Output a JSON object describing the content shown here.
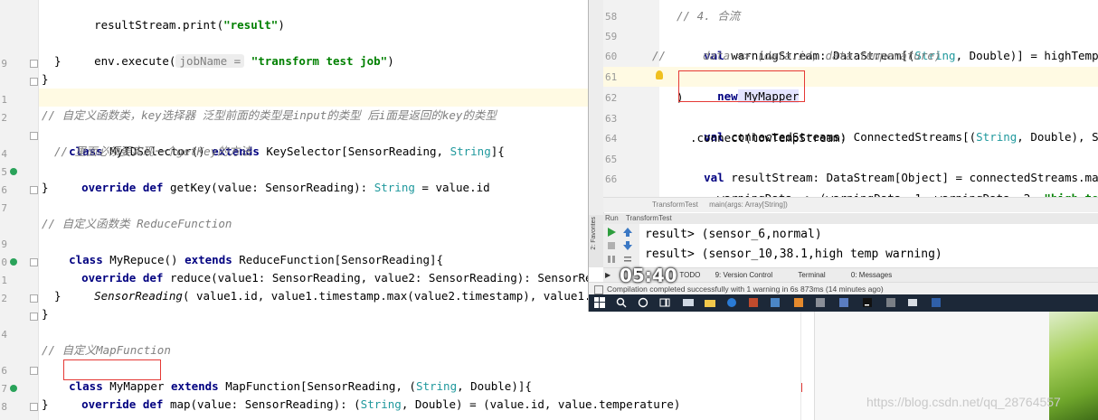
{
  "left_editor": {
    "line_numbers": [
      "",
      "",
      "",
      "9",
      "",
      "1",
      "2",
      "",
      "4",
      "5",
      "6",
      "7",
      "",
      "9",
      "0",
      "1",
      "2",
      "",
      "4",
      "",
      "6",
      "7",
      "8",
      ""
    ],
    "l_result_print_code": "resultStream.print(",
    "l_result_print_str": "\"result\"",
    "l_result_print_end": ")",
    "l_execute_code": "env.execute(",
    "l_execute_hint": "jobName =",
    "l_execute_str": "\"transform test job\"",
    "l_execute_end": ")",
    "brace_close": "}",
    "c_custom_func_class": "// 自定义函数类，key选择器 泛型前面的类型是input的类型 后i面是返回的key的类型",
    "l_idselector_kw": "class",
    "l_idselector_name": " MyIDSelector() ",
    "l_idselector_ext": "extends",
    "l_idselector_rest": " KeySelector[SensorReading, ",
    "l_idselector_type": "String",
    "l_idselector_end": "]{",
    "c_must_impl": "// 里面必须要实现一个getKey的方法",
    "l_getkey_kw": "override def",
    "l_getkey_rest": " getKey(value: SensorReading): ",
    "l_getkey_type": "String",
    "l_getkey_end": " = value.id",
    "c_reduce": "// 自定义函数类 ReduceFunction",
    "l_myrepuce_kw": "class",
    "l_myrepuce_name": " MyRepuce() ",
    "l_myrepuce_ext": "extends",
    "l_myrepuce_rest": " ReduceFunction[SensorReading]{",
    "l_reduce_kw": "override def",
    "l_reduce_rest": " reduce(value1: SensorReading, value2: SensorReading): SensorReading = {",
    "l_sensorreading_italic": "SensorReading",
    "l_sensorreading_rest": "( value1.id, value1.timestamp.max(value2.timestamp), value1.temperatur",
    "c_mapfunction": "// 自定义MapFunction",
    "l_mymapper_kw": "class",
    "l_mymapper_name": " MyMapper ",
    "l_mymapper_ext": "extends",
    "l_mymapper_rest": " MapFunction[SensorReading, (",
    "l_mymapper_type": "String",
    "l_mymapper_end": ", Double)]{",
    "l_map_kw": "override def",
    "l_map_rest": " map(value: SensorReading): (",
    "l_map_type": "String",
    "l_map_end": ", Double) = (value.id, value.temperature)"
  },
  "overlay": {
    "line_numbers": [
      "58",
      "59",
      "60",
      "61",
      "62",
      "63",
      "64",
      "65",
      "66"
    ],
    "o58": "// 4. 合流",
    "o59_kw": "val",
    "o59_a": " warningStream: DataStream[(",
    "o59_type": "String",
    "o59_b": ", Double)] = highTempStream",
    "o60_prefix": "//",
    "o60": "data => (data.id, data.temperature)",
    "o61_kw": "new",
    "o61_name": " MyMapper",
    "o62": ")",
    "o63_kw": "val",
    "o63_a": " connectedStreams: ConnectedStreams[(",
    "o63_type": "String",
    "o63_b": ", Double), SensorRe",
    "o64": ".connect(lowTempStream)",
    "o65_kw": "val",
    "o65_a": " resultStream: DataStream[Object] = connectedStreams.map(",
    "o66_a": "warningData => (warningData._1, warningData._2, ",
    "o66_str": "\"high temp war",
    "breadcrumb_class": "TransformTest",
    "breadcrumb_method": "main(args: Array[String])",
    "run_label": "Run",
    "run_tab": "TransformTest",
    "favorites_label": "2: Favorites",
    "output_line_1": "result> (sensor_6,normal)",
    "output_line_2": "result> (sensor_10,38.1,high temp warning)",
    "tab_todo": "TODO",
    "tab_version_control": "9: Version Control",
    "tab_terminal": "Terminal",
    "tab_messages": "0: Messages",
    "status": "Compilation completed successfully with 1 warning in 6s 873ms (14 minutes ago)"
  },
  "timer": "05:40",
  "watermark": "https://blog.csdn.net/qq_28764557"
}
